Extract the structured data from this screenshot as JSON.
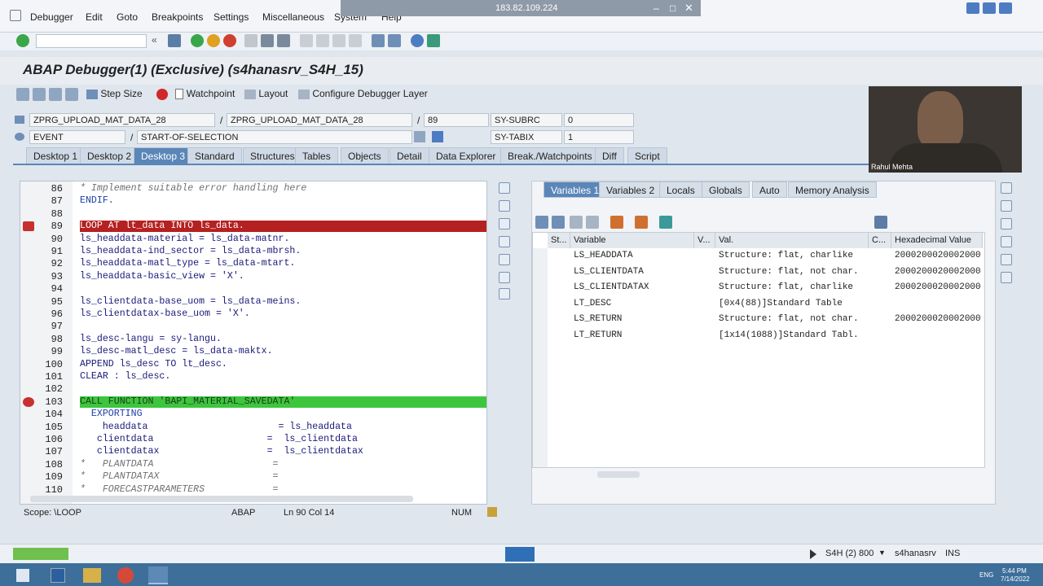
{
  "remote": {
    "ip": "183.82.109.224"
  },
  "menu": {
    "items": [
      "Debugger",
      "Edit",
      "Goto",
      "Breakpoints",
      "Settings",
      "Miscellaneous",
      "System",
      "Help"
    ]
  },
  "title": {
    "text": "ABAP Debugger(1)  (Exclusive) (s4hanasrv_S4H_15)"
  },
  "app_toolbar": {
    "step_size": "Step Size",
    "watchpoint": "Watchpoint",
    "layout": "Layout",
    "configure": "Configure Debugger Layer"
  },
  "info": {
    "program1": "ZPRG_UPLOAD_MAT_DATA_28",
    "program2": "ZPRG_UPLOAD_MAT_DATA_28",
    "line": "89",
    "subrc_label": "SY-SUBRC",
    "subrc_value": "0",
    "event_type": "EVENT",
    "event_name": "START-OF-SELECTION",
    "tabix_label": "SY-TABIX",
    "tabix_value": "1",
    "sep": "/"
  },
  "desktop_tabs": [
    "Desktop 1",
    "Desktop 2",
    "Desktop 3",
    "Standard",
    "Structures",
    "Tables",
    "Objects",
    "Detail",
    "Data Explorer",
    "Break./Watchpoints",
    "Diff",
    "Script"
  ],
  "code": {
    "lines": [
      {
        "no": "86",
        "text": "* Implement suitable error handling here",
        "cls": "cm"
      },
      {
        "no": "87",
        "text": "ENDIF.",
        "cls": "kw"
      },
      {
        "no": "88",
        "text": "",
        "cls": ""
      },
      {
        "no": "89",
        "text": "LOOP AT lt_data INTO ls_data.",
        "cls": "hl-red"
      },
      {
        "no": "90",
        "text": "ls_headdata-material = ls_data-matnr.",
        "cls": ""
      },
      {
        "no": "91",
        "text": "ls_headdata-ind_sector = ls_data-mbrsh.",
        "cls": ""
      },
      {
        "no": "92",
        "text": "ls_headdata-matl_type = ls_data-mtart.",
        "cls": ""
      },
      {
        "no": "93",
        "text": "ls_headdata-basic_view = 'X'.",
        "cls": ""
      },
      {
        "no": "94",
        "text": "",
        "cls": ""
      },
      {
        "no": "95",
        "text": "ls_clientdata-base_uom = ls_data-meins.",
        "cls": ""
      },
      {
        "no": "96",
        "text": "ls_clientdatax-base_uom = 'X'.",
        "cls": ""
      },
      {
        "no": "97",
        "text": "",
        "cls": ""
      },
      {
        "no": "98",
        "text": "ls_desc-langu = sy-langu.",
        "cls": ""
      },
      {
        "no": "99",
        "text": "ls_desc-matl_desc = ls_data-maktx.",
        "cls": ""
      },
      {
        "no": "100",
        "text": "APPEND ls_desc TO lt_desc.",
        "cls": ""
      },
      {
        "no": "101",
        "text": "CLEAR : ls_desc.",
        "cls": ""
      },
      {
        "no": "102",
        "text": "",
        "cls": ""
      },
      {
        "no": "103",
        "text": "CALL FUNCTION 'BAPI_MATERIAL_SAVEDATA'",
        "cls": "hl-green"
      },
      {
        "no": "104",
        "text": "  EXPORTING",
        "cls": "kw"
      },
      {
        "no": "105",
        "text": "    headdata                       = ls_headdata",
        "cls": ""
      },
      {
        "no": "106",
        "text": "   clientdata                    =  ls_clientdata",
        "cls": ""
      },
      {
        "no": "107",
        "text": "   clientdatax                   =  ls_clientdatax",
        "cls": ""
      },
      {
        "no": "108",
        "text": "*   PLANTDATA                     =",
        "cls": "cm"
      },
      {
        "no": "109",
        "text": "*   PLANTDATAX                    =",
        "cls": "cm"
      },
      {
        "no": "110",
        "text": "*   FORECASTPARAMETERS            =",
        "cls": "cm"
      }
    ]
  },
  "var_tabs": [
    "Variables 1",
    "Variables 2",
    "Locals",
    "Globals",
    "Auto",
    "Memory Analysis"
  ],
  "var_grid": {
    "headers": [
      "St...",
      "Variable",
      "V...",
      "Val.",
      "C...",
      "Hexadecimal Value"
    ],
    "rows": [
      {
        "name": "LS_HEADDATA",
        "val": "Structure: flat, charlike",
        "hex": "2000200020002000"
      },
      {
        "name": "LS_CLIENTDATA",
        "val": "Structure: flat, not char.",
        "hex": "2000200020002000"
      },
      {
        "name": "LS_CLIENTDATAX",
        "val": "Structure: flat, charlike",
        "hex": "2000200020002000"
      },
      {
        "name": "LT_DESC",
        "val": "[0x4(88)]Standard Table",
        "hex": ""
      },
      {
        "name": "LS_RETURN",
        "val": "Structure: flat, not char.",
        "hex": "2000200020002000"
      },
      {
        "name": "LT_RETURN",
        "val": "[1x14(1088)]Standard Tabl.",
        "hex": ""
      }
    ]
  },
  "status": {
    "scope": "Scope: \\LOOP",
    "lang": "ABAP",
    "pos": "Ln 90 Col 14",
    "num": "NUM"
  },
  "bottom": {
    "system": "S4H (2) 800",
    "server": "s4hanasrv",
    "mode": "INS"
  },
  "webcam": {
    "name": "Rahul Mehta"
  },
  "taskbar": {
    "lang": "ENG",
    "time": "5:44 PM",
    "date": "7/14/2022"
  },
  "colors": {
    "accent": "#5a86b8",
    "red_line": "#b52020",
    "green_line": "#3dc63d"
  }
}
